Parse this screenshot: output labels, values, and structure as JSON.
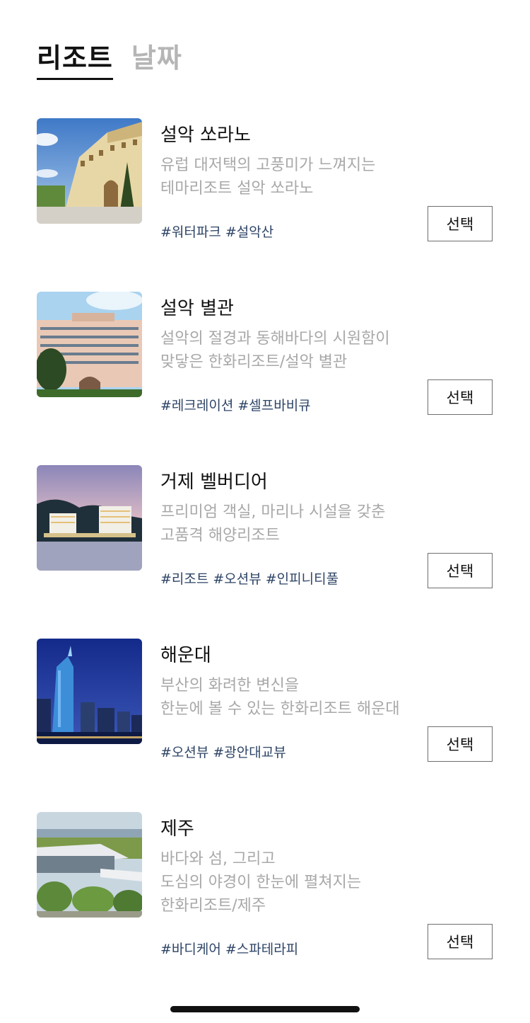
{
  "tabs": {
    "resort": "리조트",
    "date": "날짜"
  },
  "items": [
    {
      "name": "설악 쏘라노",
      "desc_1": "유럽 대저택의 고풍미가 느껴지는",
      "desc_2": "테마리조트 설악 쏘라노",
      "desc_3": "",
      "tags": [
        "#워터파크",
        "#설악산"
      ],
      "button": "선택",
      "image": "sorano-photo"
    },
    {
      "name": "설악 별관",
      "desc_1": "설악의 절경과 동해바다의 시원함이",
      "desc_2": "맞닿은 한화리조트/설악 별관",
      "desc_3": "",
      "tags": [
        "#레크레이션",
        "#셀프바비큐"
      ],
      "button": "선택",
      "image": "annex-photo"
    },
    {
      "name": "거제 벨버디어",
      "desc_1": "프리미엄 객실, 마리나 시설을 갖춘",
      "desc_2": "고품격 해양리조트",
      "desc_3": "",
      "tags": [
        "#리조트",
        "#오션뷰",
        "#인피니티풀"
      ],
      "button": "선택",
      "image": "belvedere-photo"
    },
    {
      "name": "해운대",
      "desc_1": "부산의 화려한 변신을",
      "desc_2": "한눈에 볼 수 있는 한화리조트 해운대",
      "desc_3": "",
      "tags": [
        "#오션뷰",
        "#광안대교뷰"
      ],
      "button": "선택",
      "image": "haeundae-photo"
    },
    {
      "name": "제주",
      "desc_1": "바다와 섬, 그리고",
      "desc_2": "도심의 야경이 한눈에 펼쳐지는",
      "desc_3": "한화리조트/제주",
      "tags": [
        "#바디케어",
        "#스파테라피"
      ],
      "button": "선택",
      "image": "jeju-photo"
    }
  ]
}
